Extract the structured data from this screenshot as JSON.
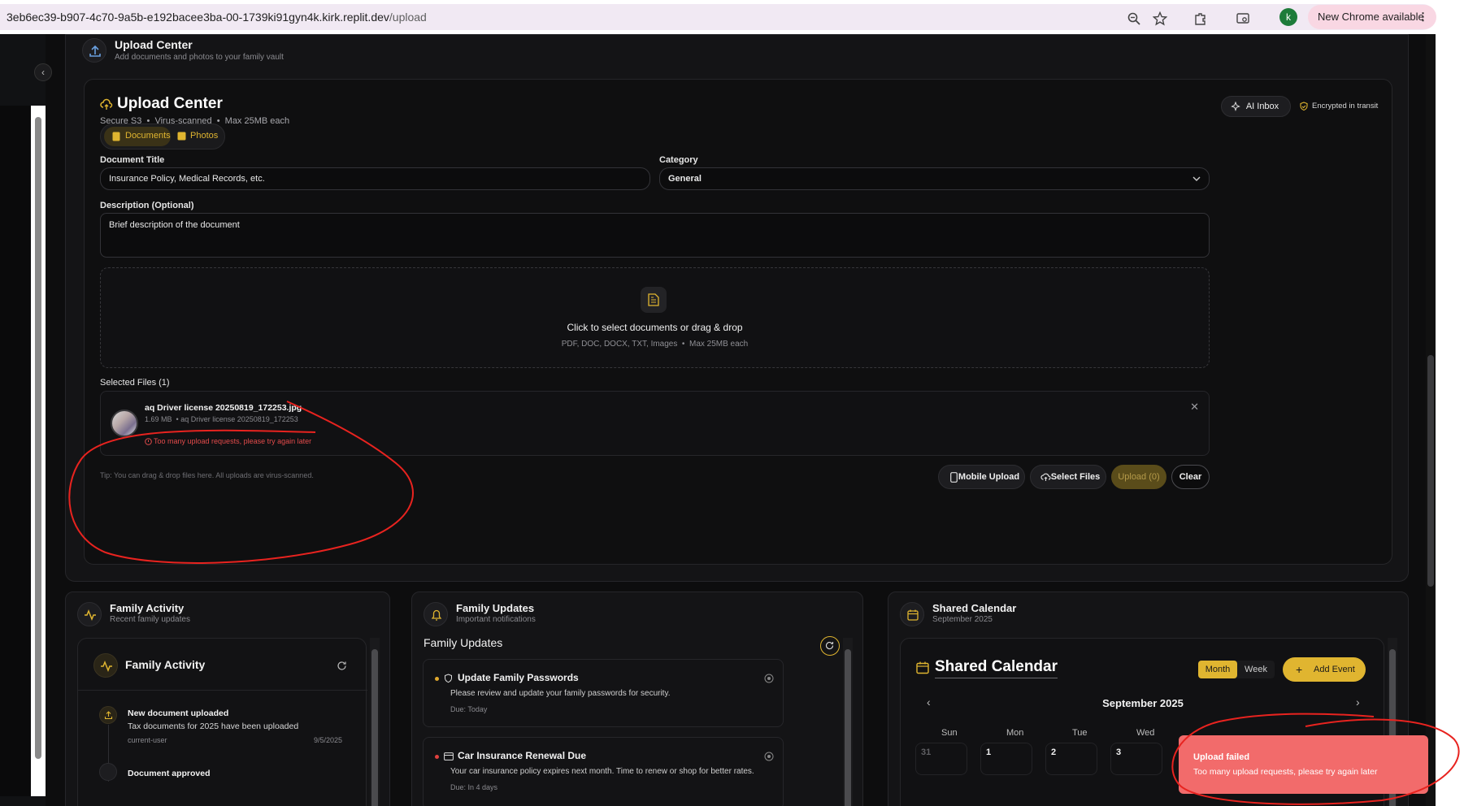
{
  "browser": {
    "url_host": "3eb6ec39-b907-4c70-9a5b-e192bacee3ba-00-1739ki91gyn4k.kirk.replit.dev",
    "url_path": "/upload",
    "avatar_letter": "k",
    "update_label": "New Chrome available"
  },
  "header": {
    "title": "Upload Center",
    "subtitle": "Add documents and photos to your family vault"
  },
  "upload": {
    "title": "Upload Center",
    "meta": [
      "Secure S3",
      "Virus-scanned",
      "Max 25MB each"
    ],
    "ai_inbox": "AI Inbox",
    "encrypted": "Encrypted in transit",
    "tabs": [
      {
        "label": "Documents",
        "active": true
      },
      {
        "label": "Photos",
        "active": false
      }
    ],
    "doc_title_label": "Document Title",
    "doc_title_placeholder": "Insurance Policy, Medical Records, etc.",
    "category_label": "Category",
    "category_value": "General",
    "description_label": "Description (Optional)",
    "description_placeholder": "Brief description of the document",
    "dropzone_title": "Click to select documents or drag & drop",
    "dropzone_types": "PDF, DOC, DOCX, TXT, Images",
    "dropzone_limit": "Max 25MB each",
    "selected_label": "Selected Files (1)",
    "file": {
      "name": "aq Driver license 20250819_172253.jpg",
      "size": "1.69 MB",
      "title": "aq Driver license 20250819_172253",
      "error": "Too many upload requests, please try again later"
    },
    "tip": "Tip: You can drag & drop files here. All uploads are virus-scanned.",
    "buttons": {
      "mobile": "Mobile Upload",
      "select": "Select Files",
      "upload": "Upload (0)",
      "clear": "Clear"
    }
  },
  "activity": {
    "title": "Family Activity",
    "subtitle": "Recent family updates",
    "inner_title": "Family Activity",
    "items": [
      {
        "title": "New document uploaded",
        "desc": "Tax documents for 2025 have been uploaded",
        "user": "current-user",
        "date": "9/5/2025"
      },
      {
        "title": "Document approved",
        "desc": "",
        "user": "",
        "date": ""
      }
    ]
  },
  "updates": {
    "title": "Family Updates",
    "subtitle": "Important notifications",
    "inner_title": "Family Updates",
    "items": [
      {
        "title": "Update Family Passwords",
        "desc": "Please review and update your family passwords for security.",
        "due": "Due: Today",
        "dot": "#e0a82e"
      },
      {
        "title": "Car Insurance Renewal Due",
        "desc": "Your car insurance policy expires next month. Time to renew or shop for better rates.",
        "due": "Due: In 4 days",
        "dot": "#e0413e"
      }
    ]
  },
  "calendar": {
    "title": "Shared Calendar",
    "subtitle": "September 2025",
    "inner_title": "Shared Calendar",
    "view_month": "Month",
    "view_week": "Week",
    "add_event": "Add Event",
    "month_label": "September 2025",
    "weekdays": [
      "Sun",
      "Mon",
      "Tue",
      "Wed"
    ],
    "first_row": [
      "31",
      "1",
      "2",
      "3"
    ]
  },
  "toast": {
    "title": "Upload failed",
    "message": "Too many upload requests, please try again later"
  },
  "colors": {
    "accent": "#e0b530",
    "error": "#e34b4b",
    "toast_bg": "#f26b6b"
  }
}
